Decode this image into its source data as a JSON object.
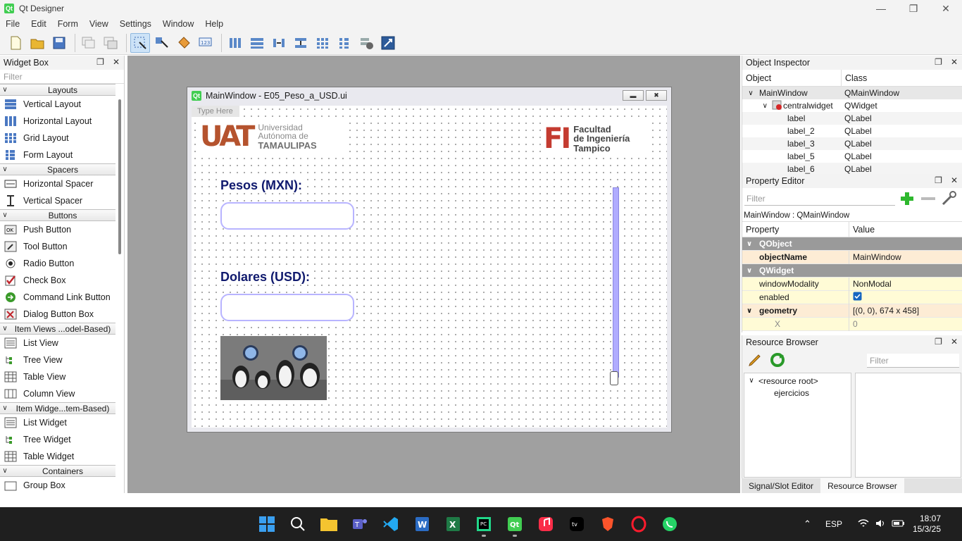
{
  "app": {
    "title": "Qt Designer"
  },
  "menu": [
    "File",
    "Edit",
    "Form",
    "View",
    "Settings",
    "Window",
    "Help"
  ],
  "widget_box": {
    "title": "Widget Box",
    "filter_placeholder": "Filter",
    "categories": [
      {
        "name": "Layouts",
        "items": [
          "Vertical Layout",
          "Horizontal Layout",
          "Grid Layout",
          "Form Layout"
        ]
      },
      {
        "name": "Spacers",
        "items": [
          "Horizontal Spacer",
          "Vertical Spacer"
        ]
      },
      {
        "name": "Buttons",
        "items": [
          "Push Button",
          "Tool Button",
          "Radio Button",
          "Check Box",
          "Command Link Button",
          "Dialog Button Box"
        ]
      },
      {
        "name": "Item Views ...odel-Based)",
        "items": [
          "List View",
          "Tree View",
          "Table View",
          "Column View"
        ]
      },
      {
        "name": "Item Widge...tem-Based)",
        "items": [
          "List Widget",
          "Tree Widget",
          "Table Widget"
        ]
      },
      {
        "name": "Containers",
        "items": [
          "Group Box"
        ]
      }
    ]
  },
  "form_window": {
    "title": "MainWindow - E05_Peso_a_USD.ui",
    "menu_placeholder": "Type Here",
    "uat_logo": {
      "mark": "UAT",
      "line1": "Universidad",
      "line2": "Autónoma de",
      "line3": "TAMAULIPAS"
    },
    "fi_logo": {
      "mark": "FI",
      "line1": "Facultad",
      "line2": "de Ingeniería",
      "line3": "Tampico"
    },
    "label_pesos": "Pesos (MXN):",
    "label_dolares": "Dolares (USD):",
    "pesos_value": "",
    "dolares_value": ""
  },
  "object_inspector": {
    "title": "Object Inspector",
    "col_object": "Object",
    "col_class": "Class",
    "rows": [
      {
        "object": "MainWindow",
        "class": "QMainWindow"
      },
      {
        "object": "centralwidget",
        "class": "QWidget"
      },
      {
        "object": "label",
        "class": "QLabel"
      },
      {
        "object": "label_2",
        "class": "QLabel"
      },
      {
        "object": "label_3",
        "class": "QLabel"
      },
      {
        "object": "label_5",
        "class": "QLabel"
      },
      {
        "object": "label_6",
        "class": "QLabel"
      }
    ]
  },
  "property_editor": {
    "title": "Property Editor",
    "filter_placeholder": "Filter",
    "class_line": "MainWindow : QMainWindow",
    "col_property": "Property",
    "col_value": "Value",
    "rows": [
      {
        "property": "QObject",
        "value": ""
      },
      {
        "property": "objectName",
        "value": "MainWindow"
      },
      {
        "property": "QWidget",
        "value": ""
      },
      {
        "property": "windowModality",
        "value": "NonModal"
      },
      {
        "property": "enabled",
        "value": ""
      },
      {
        "property": "geometry",
        "value": "[(0, 0), 674 x 458]"
      },
      {
        "property": "X",
        "value": "0"
      }
    ]
  },
  "resource_browser": {
    "title": "Resource Browser",
    "filter_placeholder": "Filter",
    "tree": [
      "<resource root>",
      "ejercicios"
    ]
  },
  "bottom_tabs": [
    "Signal/Slot Editor",
    "Resource Browser"
  ],
  "taskbar": {
    "lang": "ESP",
    "time": "18:07",
    "date": "15/3/25"
  },
  "colors": {
    "accent": "#41cd52",
    "label_text": "#101a6e",
    "input_border": "#b8b4ff",
    "slider": "#b0acff",
    "pe_group": "#9a9a9a",
    "pe_changed": "#fdecd5",
    "pe_plain": "#fffbd6",
    "uat": "#b5532e",
    "fi": "#c43b30",
    "checkbox": "#1665c1"
  }
}
